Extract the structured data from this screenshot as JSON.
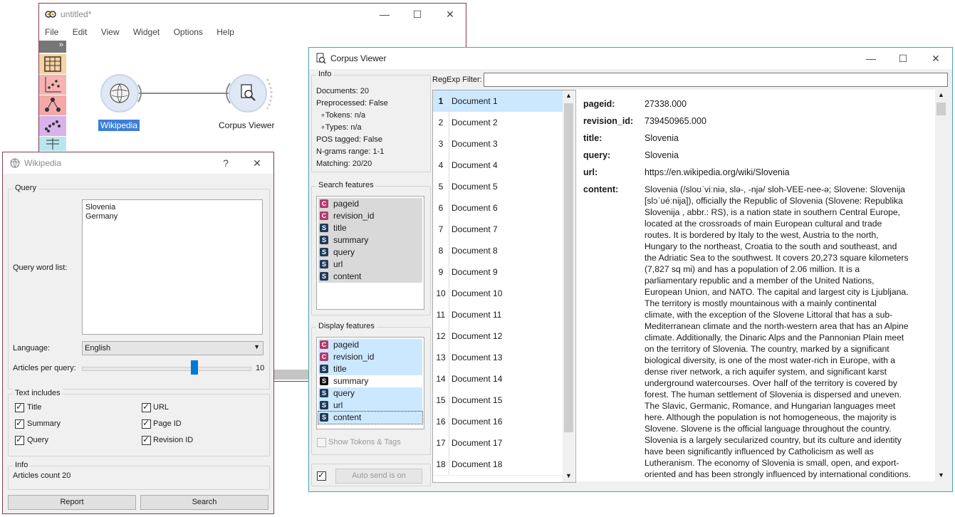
{
  "main_window": {
    "title": "untitled*",
    "menu": [
      "File",
      "Edit",
      "View",
      "Widget",
      "Options",
      "Help"
    ],
    "nodes": [
      {
        "label": "Wikipedia",
        "icon": "wikipedia-globe-icon",
        "selected": true
      },
      {
        "label": "Corpus Viewer",
        "icon": "magnifier-document-icon",
        "selected": false
      }
    ],
    "toolbox_expand": "»"
  },
  "wikipedia": {
    "title": "Wikipedia",
    "help": "?",
    "query_group": "Query",
    "query_word_list_label": "Query word list:",
    "query_text_lines": [
      "Slovenia",
      "Germany"
    ],
    "language_label": "Language:",
    "language_value": "English",
    "articles_label": "Articles per query:",
    "articles_value": "10",
    "articles_fraction": 0.67,
    "text_includes_group": "Text includes",
    "checkboxes": [
      {
        "label": "Title",
        "checked": true
      },
      {
        "label": "URL",
        "checked": true
      },
      {
        "label": "Summary",
        "checked": true
      },
      {
        "label": "Page ID",
        "checked": true
      },
      {
        "label": "Query",
        "checked": true
      },
      {
        "label": "Revision ID",
        "checked": true
      }
    ],
    "info_group": "Info",
    "info_text": "Articles count 20",
    "report_button": "Report",
    "search_button": "Search"
  },
  "corpus_viewer": {
    "title": "Corpus Viewer",
    "info_group": "Info",
    "info_lines": [
      "Documents: 20",
      "Preprocessed: False",
      "∘Tokens: n/a",
      "∘Types: n/a",
      "POS tagged: False",
      "N-grams range: 1-1",
      "Matching: 20/20"
    ],
    "search_features_group": "Search features",
    "search_features": [
      {
        "type": "C",
        "name": "pageid"
      },
      {
        "type": "C",
        "name": "revision_id"
      },
      {
        "type": "S",
        "name": "title"
      },
      {
        "type": "S",
        "name": "summary"
      },
      {
        "type": "S",
        "name": "query"
      },
      {
        "type": "S",
        "name": "url"
      },
      {
        "type": "S",
        "name": "content"
      }
    ],
    "display_features_group": "Display features",
    "display_features": [
      {
        "type": "C",
        "name": "pageid",
        "selected": true
      },
      {
        "type": "C",
        "name": "revision_id",
        "selected": true
      },
      {
        "type": "S",
        "name": "title",
        "selected": true
      },
      {
        "type": "S",
        "name": "summary",
        "selected": false
      },
      {
        "type": "S",
        "name": "query",
        "selected": true
      },
      {
        "type": "S",
        "name": "url",
        "selected": true
      },
      {
        "type": "S",
        "name": "content",
        "selected": true
      }
    ],
    "show_tokens_label": "Show Tokens & Tags",
    "auto_send_label": "Auto send is on",
    "regexp_label": "RegExp Filter:",
    "regexp_value": "",
    "documents": [
      {
        "num": "1",
        "name": "Document 1"
      },
      {
        "num": "2",
        "name": "Document 2"
      },
      {
        "num": "3",
        "name": "Document 3"
      },
      {
        "num": "4",
        "name": "Document 4"
      },
      {
        "num": "5",
        "name": "Document 5"
      },
      {
        "num": "6",
        "name": "Document 6"
      },
      {
        "num": "7",
        "name": "Document 7"
      },
      {
        "num": "8",
        "name": "Document 8"
      },
      {
        "num": "9",
        "name": "Document 9"
      },
      {
        "num": "10",
        "name": "Document 10"
      },
      {
        "num": "11",
        "name": "Document 11"
      },
      {
        "num": "12",
        "name": "Document 12"
      },
      {
        "num": "13",
        "name": "Document 13"
      },
      {
        "num": "14",
        "name": "Document 14"
      },
      {
        "num": "15",
        "name": "Document 15"
      },
      {
        "num": "16",
        "name": "Document 16"
      },
      {
        "num": "17",
        "name": "Document 17"
      },
      {
        "num": "18",
        "name": "Document 18"
      }
    ],
    "doc_fields": [
      {
        "key": "pageid:",
        "value": "27338.000"
      },
      {
        "key": "revision_id:",
        "value": "739450965.000"
      },
      {
        "key": "title:",
        "value": "Slovenia"
      },
      {
        "key": "query:",
        "value": "Slovenia"
      },
      {
        "key": "url:",
        "value": "https://en.wikipedia.org/wiki/Slovenia"
      }
    ],
    "content_key": "content:",
    "content_lines": [
      "Slovenia (/sloʊˈviːniə, slə-, -njə/ sloh-VEE-nee-ə; Slovene: Slovenija",
      "[slɔˈʋéːnija]), officially the Republic of Slovenia (Slovene: Republika",
      "Slovenija , abbr.: RS), is a nation state in southern Central Europe,",
      "located at the crossroads of main European cultural and trade",
      "routes. It is bordered by Italy to the west, Austria to the north,",
      "Hungary to the northeast, Croatia to the south and southeast, and",
      "the Adriatic Sea to the southwest. It covers 20,273 square kilometers",
      "(7,827 sq mi) and has a population of 2.06 million. It is a",
      "parliamentary republic and a member of the United Nations,",
      "European Union, and NATO. The capital and largest city is Ljubljana.",
      "The territory is mostly mountainous with a mainly continental",
      "climate, with the exception of the Slovene Littoral that has a sub-",
      "Mediterranean climate and the north-western area that has an Alpine",
      "climate. Additionally, the Dinaric Alps and the Pannonian Plain meet",
      "on the territory of Slovenia. The country, marked by a significant",
      "biological diversity, is one of the most water-rich in Europe, with a",
      "dense river network, a rich aquifer system, and significant karst",
      "underground watercourses. Over half of the territory is covered by",
      "forest. The human settlement of Slovenia is dispersed and uneven.",
      "The Slavic, Germanic, Romance, and Hungarian languages meet",
      "here. Although the population is not homogeneous, the majority is",
      "Slovene. Slovene is the official language throughout the country.",
      "Slovenia is a largely secularized country, but its culture and identity",
      "have been significantly influenced by Catholicism as well as",
      "Lutheranism. The economy of Slovenia is small, open, and export-",
      "oriented and has been strongly influenced by international conditions."
    ]
  },
  "colors": {
    "selection": "#cce8ff",
    "main_border": "#8a3a55",
    "viewer_border": "#4aa3a8"
  }
}
